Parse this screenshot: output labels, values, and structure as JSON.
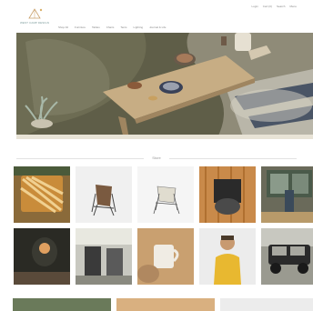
{
  "brand": {
    "logo_text": "WEST CAMP DESIGN"
  },
  "nav": {
    "items": [
      "Shop All",
      "Furniture",
      "Tables",
      "Chairs",
      "Tents",
      "Lighting",
      "Journal & Life"
    ]
  },
  "utility": {
    "items": [
      "Login",
      "Cart (0)",
      "Search",
      "Menu"
    ]
  },
  "section": {
    "title": "Store"
  },
  "grid": {
    "products": [
      "Vanguard tile rack",
      "Folding camp chair",
      "Low camp chair",
      "Cast iron grill pan",
      "Outdoor store front",
      "Wood fire stove",
      "Camp table set",
      "Coffee mug",
      "Yellow parka",
      "Vintage jeep"
    ]
  }
}
